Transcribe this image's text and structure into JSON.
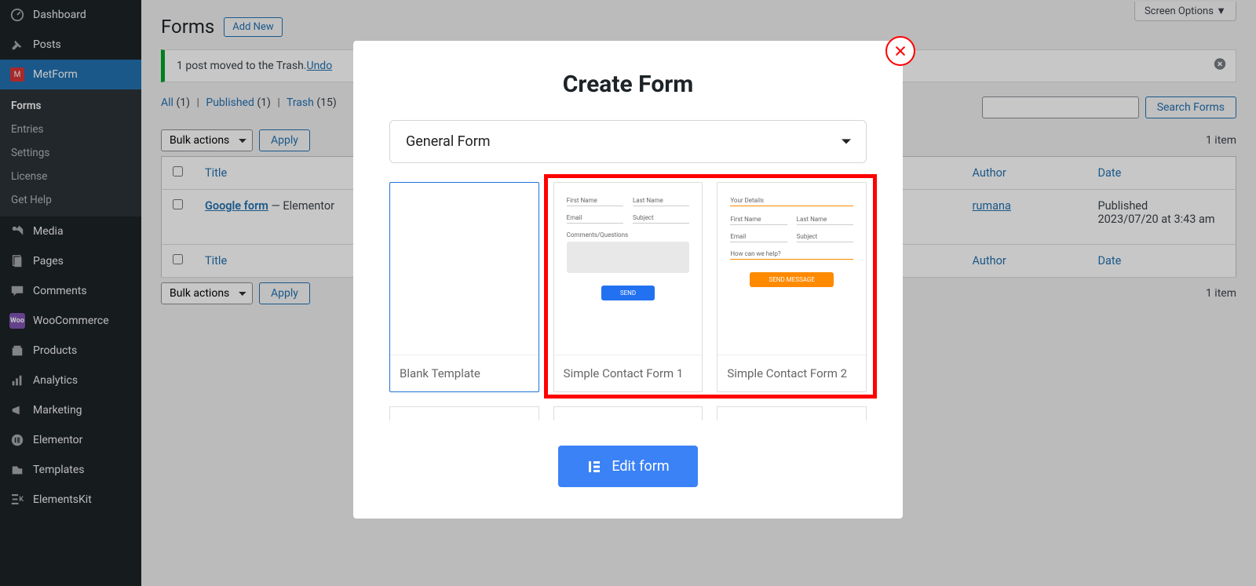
{
  "sidebar": {
    "items": [
      {
        "label": "Dashboard"
      },
      {
        "label": "Posts"
      },
      {
        "label": "MetForm"
      },
      {
        "label": "Media"
      },
      {
        "label": "Pages"
      },
      {
        "label": "Comments"
      },
      {
        "label": "WooCommerce"
      },
      {
        "label": "Products"
      },
      {
        "label": "Analytics"
      },
      {
        "label": "Marketing"
      },
      {
        "label": "Elementor"
      },
      {
        "label": "Templates"
      },
      {
        "label": "ElementsKit"
      }
    ],
    "sub": {
      "forms": "Forms",
      "entries": "Entries",
      "settings": "Settings",
      "license": "License",
      "get_help": "Get Help"
    }
  },
  "header": {
    "screen_options": "Screen Options ▼",
    "page_title": "Forms",
    "add_new": "Add New"
  },
  "notice": {
    "message": "1 post moved to the Trash. ",
    "undo": "Undo"
  },
  "subsubsub": {
    "all_label": "All",
    "all_count": "(1)",
    "published_label": "Published",
    "published_count": "(1)",
    "trash_label": "Trash",
    "trash_count": "(15)"
  },
  "actions": {
    "bulk_label": "Bulk actions",
    "apply": "Apply",
    "search_placeholder": "",
    "search_button": "Search Forms",
    "item_count": "1 item"
  },
  "table": {
    "col_title": "Title",
    "col_author": "Author",
    "col_date": "Date",
    "row": {
      "title": "Google form",
      "suffix": " — Elementor",
      "author": "rumana",
      "date_status": "Published",
      "date_val": "2023/07/20 at 3:43 am"
    }
  },
  "modal": {
    "title": "Create Form",
    "form_type": "General Form",
    "templates": {
      "blank": "Blank Template",
      "simple1": "Simple Contact Form 1",
      "simple2": "Simple Contact Form 2"
    },
    "edit_form": "Edit form",
    "preview1": {
      "first_name": "First Name",
      "last_name": "Last Name",
      "email": "Email",
      "subject": "Subject",
      "comments": "Comments/Questions",
      "send": "SEND"
    },
    "preview2": {
      "your_details": "Your Details",
      "first_name": "First Name",
      "last_name": "Last Name",
      "email": "Email",
      "subject": "Subject",
      "help": "How can we help?",
      "send": "SEND MESSAGE"
    }
  },
  "colors": {
    "accent": "#2271b1",
    "highlight": "#ff0000",
    "modal_button": "#3b82f6",
    "orange": "#ff8a00"
  }
}
